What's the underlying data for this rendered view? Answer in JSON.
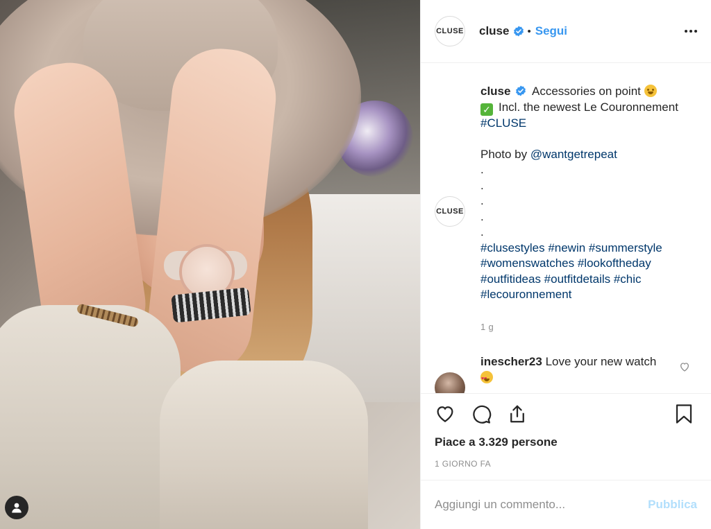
{
  "header": {
    "logo_text": "CLUSE",
    "username": "cluse",
    "separator": "•",
    "follow_label": "Segui"
  },
  "caption": {
    "logo_text": "CLUSE",
    "username": "cluse",
    "line1_text": "Accessories on point",
    "line2_text": "Incl. the newest Le Couronnement",
    "hashtag_brand": "#CLUSE",
    "photo_by": "Photo by",
    "photo_by_handle": "@wantgetrepeat",
    "dots": [
      ".",
      ".",
      ".",
      ".",
      "."
    ],
    "hashtags": "#clusestyles #newin #summerstyle #womenswatches #lookoftheday #outfitideas #outfitdetails #chic #lecouronnement",
    "time": "1 g"
  },
  "comment": {
    "username": "inescher23",
    "text": "Love your new watch"
  },
  "actions": {
    "likes_text": "Piace a 3.329 persone",
    "date_text": "1 GIORNO FA"
  },
  "add_comment": {
    "placeholder": "Aggiungi un commento...",
    "publish_label": "Pubblica"
  },
  "colors": {
    "link_blue": "#3897f0",
    "hashtag_blue": "#00376b",
    "muted": "#8e8e8e",
    "publish_disabled": "#b2dffc"
  },
  "icons": {
    "verified": "verified-badge-icon",
    "more": "more-options-icon",
    "like": "heart-icon",
    "comment": "comment-bubble-icon",
    "share": "share-icon",
    "save": "bookmark-icon",
    "user": "user-silhouette-icon"
  }
}
